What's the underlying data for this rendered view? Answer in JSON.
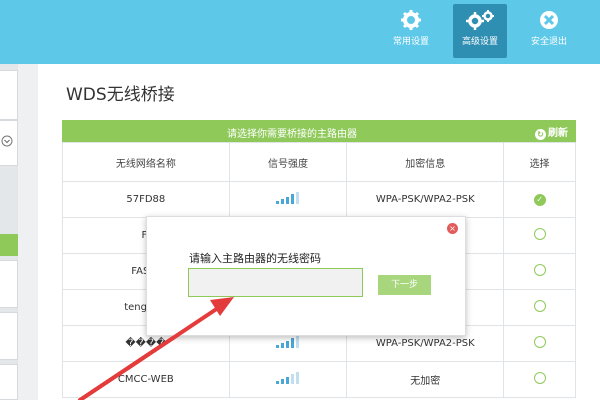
{
  "topbar": {
    "buttons": [
      {
        "label": "常用设置",
        "icon": "gear-icon"
      },
      {
        "label": "高级设置",
        "icon": "gears-icon",
        "active": true
      },
      {
        "label": "安全退出",
        "icon": "exit-icon"
      }
    ]
  },
  "page": {
    "title": "WDS无线桥接",
    "hint": "请选择你需要桥接的主路由器",
    "refresh_label": "刷新"
  },
  "table": {
    "headers": [
      "无线网络名称",
      "信号强度",
      "加密信息",
      "选择"
    ],
    "rows": [
      {
        "name": "57FD88",
        "signal": 4,
        "encryption": "WPA-PSK/WPA2-PSK",
        "selected": true
      },
      {
        "name": "FI",
        "signal": 3,
        "encryption": "K",
        "selected": false
      },
      {
        "name": "FAST_",
        "signal": 3,
        "encryption": "K",
        "selected": false
      },
      {
        "name": "tengdazl",
        "signal": 2,
        "encryption": "K",
        "selected": false
      },
      {
        "name": "����",
        "signal": 4,
        "encryption": "WPA-PSK/WPA2-PSK",
        "selected": false
      },
      {
        "name": "CMCC-WEB",
        "signal": 3,
        "encryption": "无加密",
        "selected": false
      }
    ]
  },
  "dialog": {
    "title": "请输入主路由器的无线密码",
    "password_value": "",
    "next_label": "下一步"
  },
  "colors": {
    "topbar": "#5ec8e9",
    "accent_green": "#8fc95a",
    "arrow_red": "#e43b3b",
    "signal_blue": "#4aa6d6"
  }
}
